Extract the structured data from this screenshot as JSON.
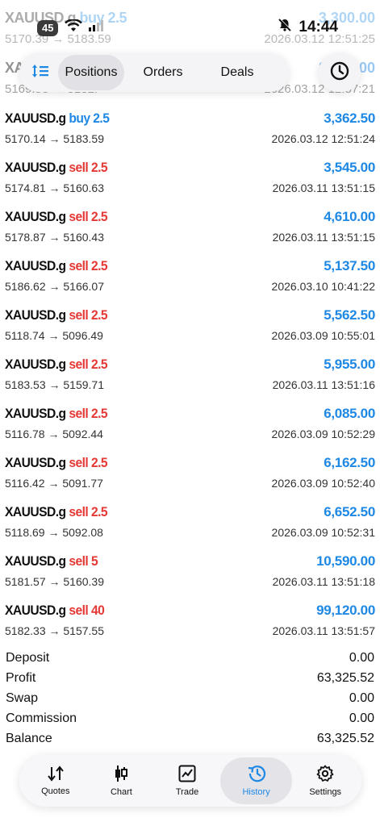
{
  "status_bar": {
    "battery": "45",
    "time": "14:44"
  },
  "ghost_rows": [
    {
      "symbol": "XAUUSD.g",
      "side": "buy 2.5",
      "prices": "5170.39 → 5183.59",
      "profit": "3,300.00",
      "time": "2026.03.12 12:51:25"
    },
    {
      "symbol": "XAUUSD.g",
      "side": "buy",
      "prices": "5169.53 → 5182.",
      "profit": "3,300.00",
      "time": "2026.03.12 12:57:21"
    }
  ],
  "tabs": {
    "positions": "Positions",
    "orders": "Orders",
    "deals": "Deals"
  },
  "deals": [
    {
      "symbol": "XAUUSD.g",
      "side": "buy 2.5",
      "type": "buy",
      "prices": "5170.14 → 5183.59",
      "profit": "3,362.50",
      "time": "2026.03.12 12:51:24"
    },
    {
      "symbol": "XAUUSD.g",
      "side": "sell 2.5",
      "type": "sell",
      "prices": "5174.81 → 5160.63",
      "profit": "3,545.00",
      "time": "2026.03.11 13:51:15"
    },
    {
      "symbol": "XAUUSD.g",
      "side": "sell 2.5",
      "type": "sell",
      "prices": "5178.87 → 5160.43",
      "profit": "4,610.00",
      "time": "2026.03.11 13:51:15"
    },
    {
      "symbol": "XAUUSD.g",
      "side": "sell 2.5",
      "type": "sell",
      "prices": "5186.62 → 5166.07",
      "profit": "5,137.50",
      "time": "2026.03.10 10:41:22"
    },
    {
      "symbol": "XAUUSD.g",
      "side": "sell 2.5",
      "type": "sell",
      "prices": "5118.74 → 5096.49",
      "profit": "5,562.50",
      "time": "2026.03.09 10:55:01"
    },
    {
      "symbol": "XAUUSD.g",
      "side": "sell 2.5",
      "type": "sell",
      "prices": "5183.53 → 5159.71",
      "profit": "5,955.00",
      "time": "2026.03.11 13:51:16"
    },
    {
      "symbol": "XAUUSD.g",
      "side": "sell 2.5",
      "type": "sell",
      "prices": "5116.78 → 5092.44",
      "profit": "6,085.00",
      "time": "2026.03.09 10:52:29"
    },
    {
      "symbol": "XAUUSD.g",
      "side": "sell 2.5",
      "type": "sell",
      "prices": "5116.42 → 5091.77",
      "profit": "6,162.50",
      "time": "2026.03.09 10:52:40"
    },
    {
      "symbol": "XAUUSD.g",
      "side": "sell 2.5",
      "type": "sell",
      "prices": "5118.69 → 5092.08",
      "profit": "6,652.50",
      "time": "2026.03.09 10:52:31"
    },
    {
      "symbol": "XAUUSD.g",
      "side": "sell 5",
      "type": "sell",
      "prices": "5181.57 → 5160.39",
      "profit": "10,590.00",
      "time": "2026.03.11 13:51:18"
    },
    {
      "symbol": "XAUUSD.g",
      "side": "sell 40",
      "type": "sell",
      "prices": "5182.33 → 5157.55",
      "profit": "99,120.00",
      "time": "2026.03.11 13:51:57"
    }
  ],
  "summary": [
    {
      "label": "Deposit",
      "value": "0.00"
    },
    {
      "label": "Profit",
      "value": "63,325.52"
    },
    {
      "label": "Swap",
      "value": "0.00"
    },
    {
      "label": "Commission",
      "value": "0.00"
    },
    {
      "label": "Balance",
      "value": "63,325.52"
    }
  ],
  "nav": {
    "quotes": "Quotes",
    "chart": "Chart",
    "trade": "Trade",
    "history": "History",
    "settings": "Settings",
    "active": "history"
  },
  "colors": {
    "buy": "#1e88e5",
    "sell": "#e53935",
    "profit": "#1e88e5",
    "accent": "#1e88e5"
  },
  "icons": [
    "battery-icon",
    "wifi-icon",
    "signal-icon",
    "bell-muted-icon",
    "sort-icon",
    "clock-icon",
    "quotes-icon",
    "chart-icon",
    "trade-icon",
    "history-icon",
    "settings-icon"
  ]
}
